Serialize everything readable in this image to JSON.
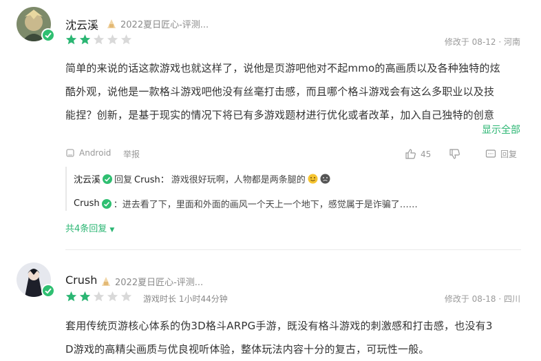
{
  "reviews": [
    {
      "username": "沈云溪",
      "badge": "2022夏日匠心-评测...",
      "rating": 2,
      "meta": "修改于 08-12 · 河南",
      "lines": [
        "简单的来说的话这款游戏也就这样了，说他是页游吧他对不起mmo的高画质以及各种独特的炫",
        "酷外观，说他是一款格斗游戏吧他没有丝毫打击感，而且哪个格斗游戏会有这么多职业以及技",
        "能捏？创新，是基于现实的情况下将已有多游戏题材进行优化或者改革，加入自己独特的创意"
      ],
      "show_all": "显示全部",
      "footer": {
        "device": "Android",
        "report": "举报",
        "likes": "45",
        "reply": "回复"
      },
      "replies": [
        {
          "name": "沈云溪",
          "verb": "回复",
          "target": "Crush：",
          "text": "游戏很好玩啊，人物都是两条腿的"
        },
        {
          "name": "Crush",
          "text": "：进去看了下，里面和外面的画风一个天上一个地下，感觉属于是诈骗了……"
        }
      ],
      "more_replies": "共4条回复"
    },
    {
      "username": "Crush",
      "badge": "2022夏日匠心-评测...",
      "rating": 2,
      "playtime": "游戏时长 1小时44分钟",
      "meta": "修改于 08-18 · 四川",
      "lines": [
        "套用传统页游核心体系的伪3D格斗ARPG手游，既没有格斗游戏的刺激感和打击感，也没有3",
        "D游戏的高精尖画质与优良视听体验，整体玩法内容十分的复古，可玩性一般。"
      ]
    }
  ],
  "colors": {
    "accent": "#2bb673",
    "star_on": "#2bb673",
    "star_off": "#d9d9d9"
  }
}
